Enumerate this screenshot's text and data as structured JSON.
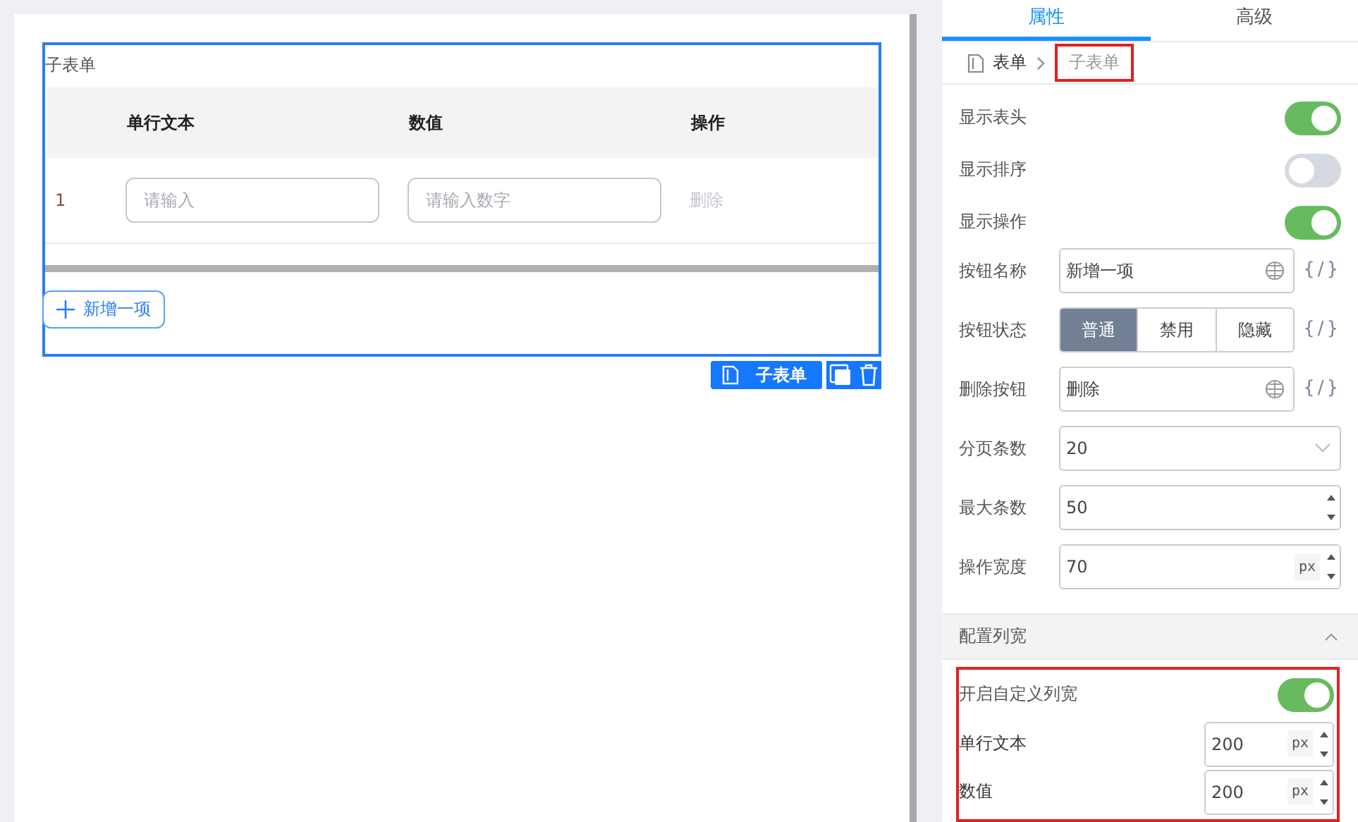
{
  "canvas": {
    "component": {
      "selected": true,
      "title": "子表单",
      "columns": [
        "单行文本",
        "数值",
        "操作"
      ],
      "rows": [
        {
          "index": "1",
          "cells": [
            {
              "kind": "input",
              "placeholder": "请输入"
            },
            {
              "kind": "input",
              "placeholder": "请输入数字"
            },
            {
              "kind": "link",
              "text": "删除",
              "disabled": true
            }
          ]
        }
      ],
      "add_button": "新增一项"
    },
    "toolbar": {
      "label": "子表单"
    }
  },
  "panel": {
    "tabs": [
      {
        "label": "属性",
        "selected": true
      },
      {
        "label": "高级",
        "selected": false
      }
    ],
    "breadcrumb": [
      {
        "label": "表单",
        "highlighted": false
      },
      {
        "label": "子表单",
        "highlighted": true
      }
    ],
    "properties": [
      {
        "kind": "toggle",
        "label": "显示表头",
        "on": true
      },
      {
        "kind": "toggle",
        "label": "显示排序",
        "on": false
      },
      {
        "kind": "toggle",
        "label": "显示操作",
        "on": true
      },
      {
        "kind": "text",
        "label": "按钮名称",
        "value": "新增一项",
        "expr": "{/}"
      },
      {
        "kind": "segmented",
        "label": "按钮状态",
        "options": [
          {
            "label": "普通",
            "selected": true
          },
          {
            "label": "禁用",
            "selected": false
          },
          {
            "label": "隐藏",
            "selected": false
          }
        ],
        "expr": "{/}"
      },
      {
        "kind": "text",
        "label": "删除按钮",
        "value": "删除",
        "expr": "{/}"
      },
      {
        "kind": "select",
        "label": "分页条数",
        "value": "20"
      },
      {
        "kind": "number",
        "label": "最大条数",
        "value": "50"
      },
      {
        "kind": "number",
        "label": "操作宽度",
        "value": "70",
        "unit": "px"
      }
    ],
    "section": {
      "title": "配置列宽",
      "expanded": true,
      "highlighted": true,
      "toggle": {
        "label": "开启自定义列宽",
        "on": true
      },
      "widths": [
        {
          "label": "单行文本",
          "value": "200",
          "unit": "px"
        },
        {
          "label": "数值",
          "value": "200",
          "unit": "px"
        }
      ]
    }
  }
}
